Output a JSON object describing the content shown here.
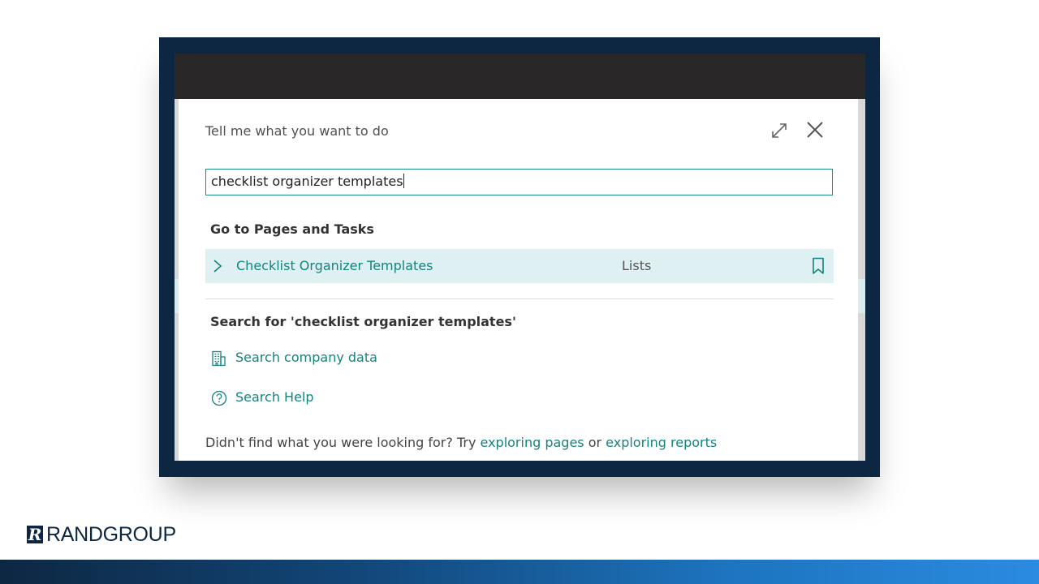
{
  "dialog": {
    "title": "Tell me what you want to do",
    "search_value": "checklist organizer templates",
    "section_pages": "Go to Pages and Tasks",
    "result": {
      "label": "Checklist Organizer Templates",
      "category": "Lists"
    },
    "section_search": "Search for 'checklist organizer templates'",
    "actions": [
      {
        "label": "Search company data",
        "icon": "building-icon"
      },
      {
        "label": "Search Help",
        "icon": "help-circle-icon"
      }
    ],
    "footer": {
      "prefix": "Didn't find what you were looking for? Try ",
      "link1": "exploring pages",
      "middle": " or ",
      "link2": "exploring reports"
    }
  },
  "brand": {
    "mark": "R",
    "name_bold": "RAND",
    "name_light": "GROUP"
  },
  "colors": {
    "accent": "#15837e",
    "frame": "#0d2742",
    "highlight": "#dff0f2"
  }
}
